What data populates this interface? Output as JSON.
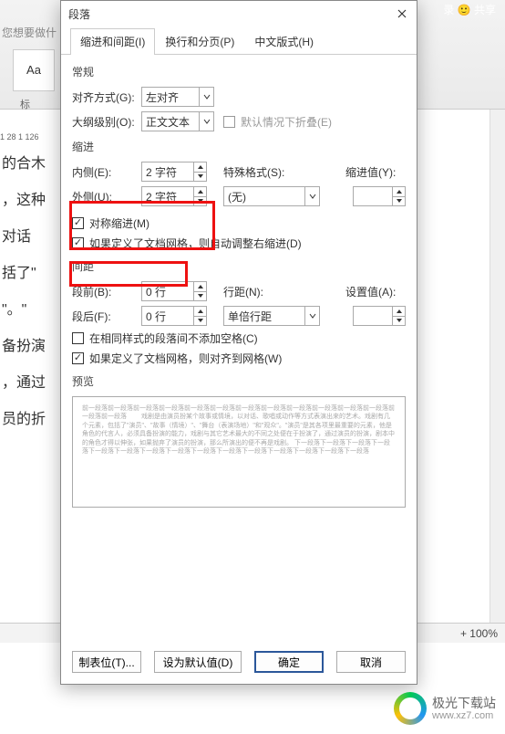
{
  "window": {
    "share_label": "录  🙂 共享",
    "prompt": "您想要做什",
    "style_sample": "Aa",
    "style_caption": "标",
    "ruler_marks": "1 28   1  126",
    "zoom": "+    100%"
  },
  "dialog": {
    "title": "段落",
    "close_tooltip": "关闭",
    "tabs": [
      "缩进和间距(I)",
      "换行和分页(P)",
      "中文版式(H)"
    ],
    "sections": {
      "general": "常规",
      "indent": "缩进",
      "spacing": "间距",
      "preview": "预览"
    },
    "labels": {
      "alignment": "对齐方式(G):",
      "outline": "大纲级别(O):",
      "default_collapse": "默认情况下折叠(E)",
      "inside": "内侧(E):",
      "outside": "外侧(U):",
      "special": "特殊格式(S):",
      "indent_value": "缩进值(Y):",
      "mirror_indent": "对称缩进(M)",
      "grid_adjust_indent": "如果定义了文档网格，则自动调整右缩进(D)",
      "before": "段前(B):",
      "after": "段后(F):",
      "line_spacing": "行距(N):",
      "set_value": "设置值(A):",
      "no_space_same_style": "在相同样式的段落间不添加空格(C)",
      "grid_align": "如果定义了文档网格，则对齐到网格(W)"
    },
    "values": {
      "alignment": "左对齐",
      "outline": "正文文本",
      "inside": "2 字符",
      "outside": "2 字符",
      "special": "(无)",
      "indent_value": "",
      "before": "0 行",
      "after": "0 行",
      "line_spacing": "单倍行距",
      "set_value": ""
    },
    "checkboxes": {
      "default_collapse": false,
      "mirror_indent": true,
      "grid_adjust_indent": true,
      "no_space_same_style": false,
      "grid_align": true
    },
    "preview_text": "前一段落前一段落前一段落前一段落前一段落前一段落前一段落前一段落前一段落前一段落前一段落前一段落前一段落前一段落\n　　戏剧是由演员扮某个故事或情境，以对话、歌唱或动作等方式表演出来的艺术。戏剧有几个元素，包括了\"演员\"、\"故事（情境）\"、\"舞台（表演场地）\"和\"观众\"。\"演员\"是其各项里最重要的元素，他是角色的代言人，必须具备扮演的能力，戏剧与其它艺术最大的不同之处便在于扮演了，通过演员的扮演，剧本中的角色才得以伸张，如果抛弃了演员的扮演，那么所演出的便不再是戏剧。\n下一段落下一段落下一段落下一段落下一段落下一段落下一段落下一段落下一段落下一段落下一段落下一段落下一段落下一段落下一段落",
    "footer": {
      "tabs_btn": "制表位(T)...",
      "default_btn": "设为默认值(D)",
      "ok": "确定",
      "cancel": "取消"
    }
  },
  "doc_fragments": [
    "的合木",
    "，这种",
    "对话",
    "括了\"",
    "\"。\"",
    "备扮演",
    "，通过",
    "员的折"
  ],
  "watermark": {
    "name": "极光下载站",
    "url": "www.xz7.com"
  }
}
